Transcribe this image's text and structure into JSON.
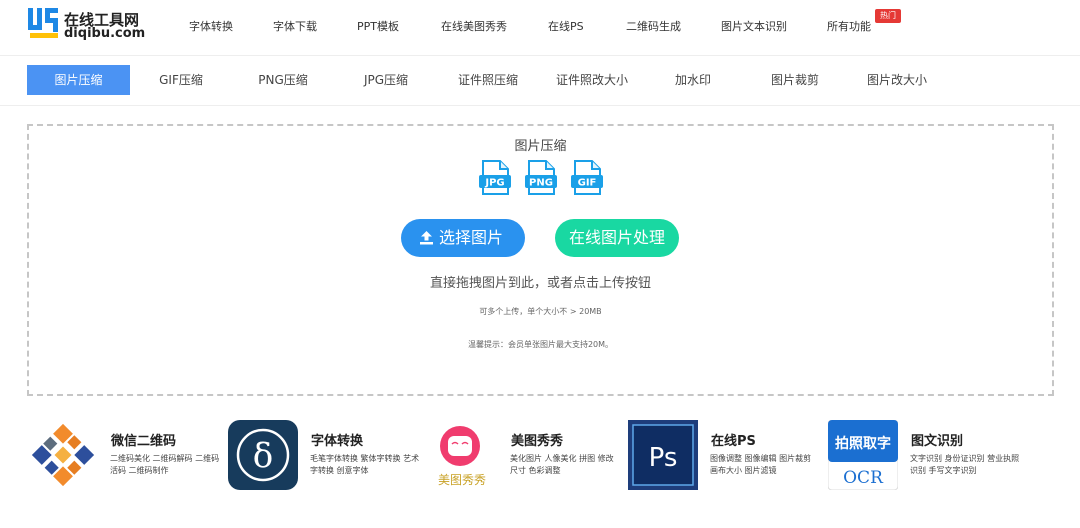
{
  "logo": {
    "name": "在线工具网",
    "domain": "diqibu.com"
  },
  "top_nav": [
    "字体转换",
    "字体下载",
    "PPT模板",
    "在线美图秀秀",
    "在线PS",
    "二维码生成",
    "图片文本识别",
    "所有功能"
  ],
  "hot_badge": "热门",
  "sub_nav": [
    "图片压缩",
    "GIF压缩",
    "PNG压缩",
    "JPG压缩",
    "证件照压缩",
    "证件照改大小",
    "加水印",
    "图片裁剪",
    "图片改大小"
  ],
  "upload": {
    "title": "图片压缩",
    "formats": [
      "JPG",
      "PNG",
      "GIF"
    ],
    "select_button": "选择图片",
    "online_button": "在线图片处理",
    "hint": "直接拖拽图片到此，或者点击上传按钮",
    "limit": "可多个上传，单个大小不 > 20MB",
    "tip": "温馨提示：会员单张图片最大支持20M。"
  },
  "cards": [
    {
      "title": "微信二维码",
      "desc": "二维码美化 二维码解码 二维码活码 二维码制作"
    },
    {
      "title": "字体转换",
      "desc": "毛笔字体转换 繁体字转换 艺术字转换 创意字体"
    },
    {
      "title": "美图秀秀",
      "desc": "美化图片 人像美化 拼图 修改尺寸 色彩调整",
      "logo_text": "美图秀秀"
    },
    {
      "title": "在线PS",
      "desc": "图像调整 图像编辑 图片裁剪 画布大小 图片滤镜",
      "logo_text": "Ps"
    },
    {
      "title": "图文识别",
      "desc": "文字识别 身份证识别 营业执照识别 手写文字识别",
      "logo_text_top": "拍照取字",
      "logo_text_bottom": "OCR"
    }
  ],
  "colors": {
    "active_tab": "#4b93f3",
    "select_button": "#2a92ef",
    "online_button": "#19d8a2",
    "hot_badge": "#e53935",
    "ps_blue": "#1e3d7b",
    "font_card": "#173b5c"
  }
}
